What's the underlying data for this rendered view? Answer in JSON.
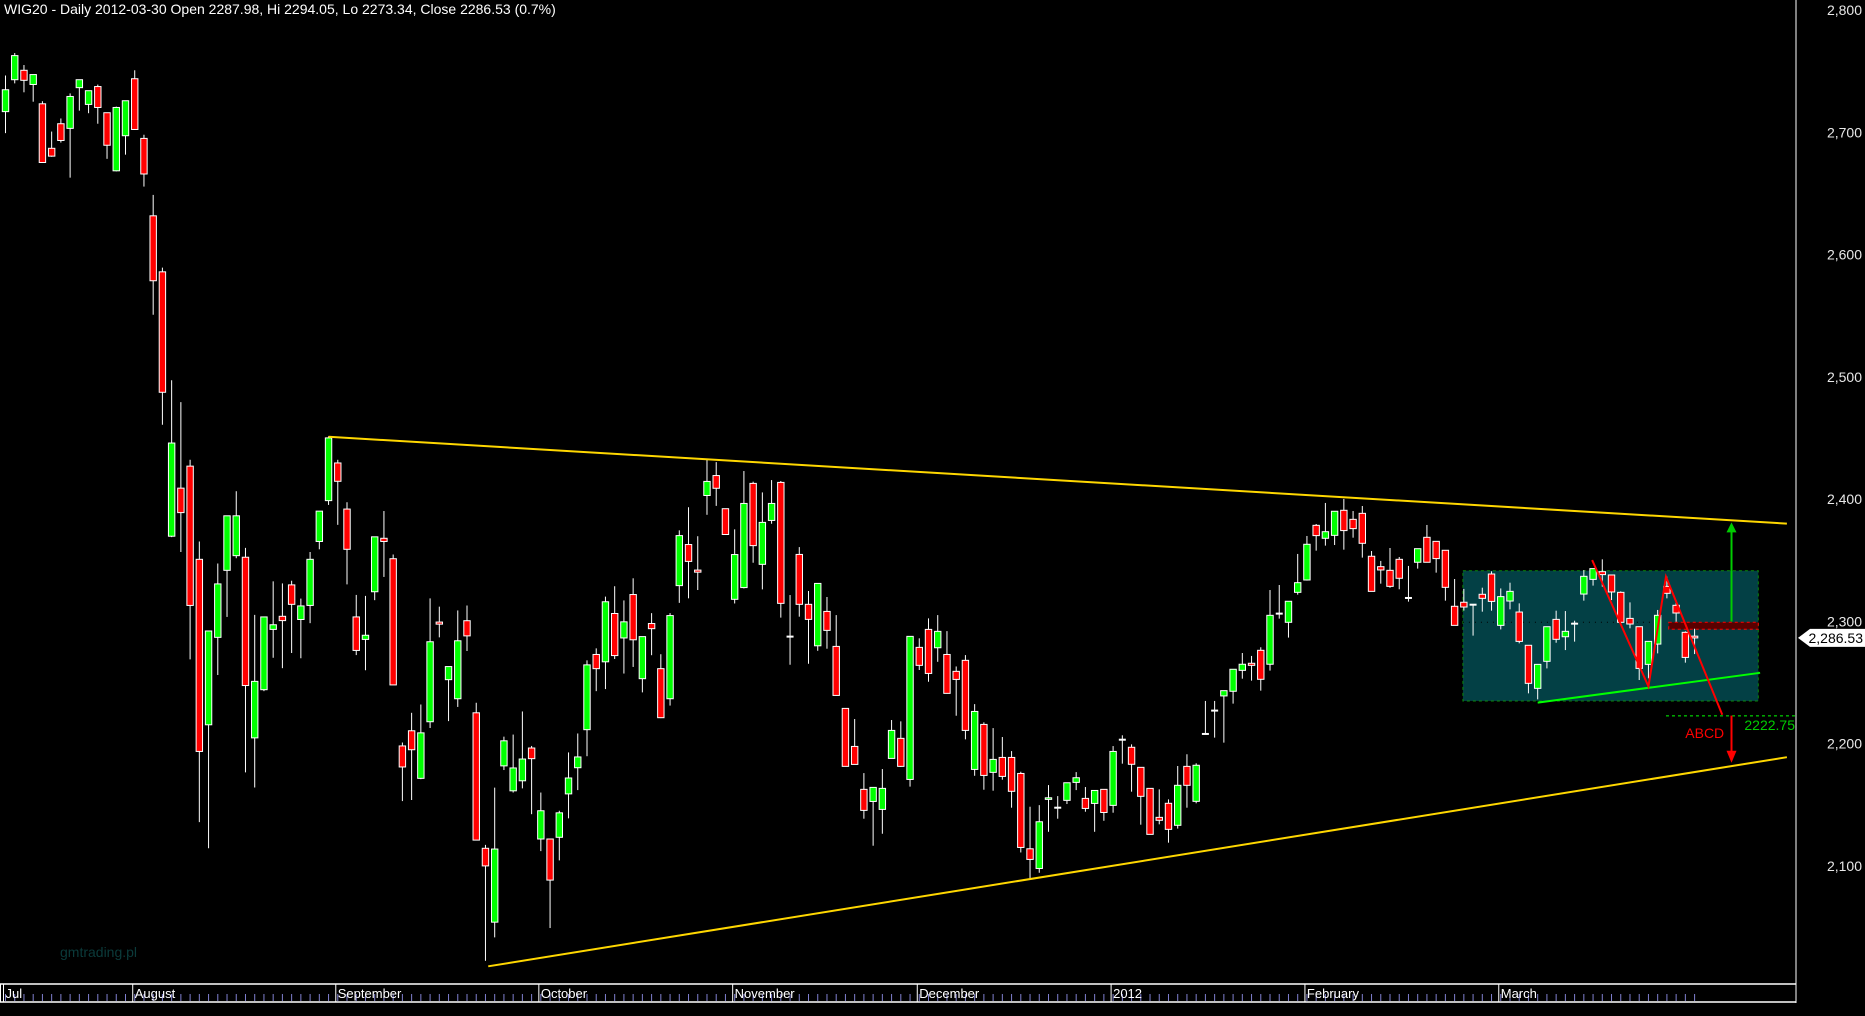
{
  "header": {
    "title": "WIG20 - Daily 2012-03-30 Open 2287.98, Hi 2294.05, Lo 2273.34, Close 2286.53 (0.7%)"
  },
  "watermark": "gmtrading.pl",
  "colors": {
    "background": "#000000",
    "up": "#00ff00",
    "down": "#ff0000",
    "trendline": "#ffd700",
    "box_fill": "#034045",
    "box_border": "#0a8a0a",
    "support": "#00ff00",
    "abcd": "#ff0000",
    "target_green": "#00cc00"
  },
  "chart_data": {
    "type": "candlestick",
    "symbol": "WIG20",
    "period": "Daily",
    "ylim": [
      2000,
      2800
    ],
    "y_ticks": [
      {
        "value": 2800,
        "label": "2,800"
      },
      {
        "value": 2700,
        "label": "2,700"
      },
      {
        "value": 2600,
        "label": "2,600"
      },
      {
        "value": 2500,
        "label": "2,500"
      },
      {
        "value": 2400,
        "label": "2,400"
      },
      {
        "value": 2300,
        "label": "2,300"
      },
      {
        "value": 2200,
        "label": "2,200"
      },
      {
        "value": 2100,
        "label": "2,100"
      }
    ],
    "x_months": [
      {
        "bar": 1,
        "label": "Jul"
      },
      {
        "bar": 15,
        "label": "August"
      },
      {
        "bar": 37,
        "label": "September"
      },
      {
        "bar": 59,
        "label": "October"
      },
      {
        "bar": 80,
        "label": "November"
      },
      {
        "bar": 100,
        "label": "December"
      },
      {
        "bar": 121,
        "label": "2012"
      },
      {
        "bar": 142,
        "label": "February"
      },
      {
        "bar": 163,
        "label": "March"
      }
    ],
    "last_price": {
      "value": 2286.53,
      "label": "2,286.53"
    },
    "ohlc_columns": [
      "open",
      "high",
      "low",
      "close"
    ],
    "candles": [
      [
        2716.9,
        2746.4,
        2699.3,
        2734.8
      ],
      [
        2743,
        2764.8,
        2740,
        2762.7
      ],
      [
        2750.7,
        2755,
        2732.7,
        2742.5
      ],
      [
        2739.1,
        2747.2,
        2725,
        2747.2
      ],
      [
        2723.3,
        2725.4,
        2675,
        2675.3
      ],
      [
        2686.9,
        2700.6,
        2680,
        2680.5
      ],
      [
        2707,
        2711.3,
        2691.6,
        2693.3
      ],
      [
        2703.2,
        2731.8,
        2662.9,
        2729.3
      ],
      [
        2736.5,
        2743,
        2717.7,
        2743
      ],
      [
        2722.8,
        2734,
        2715.6,
        2734
      ],
      [
        2737.4,
        2739,
        2707,
        2720.3
      ],
      [
        2716,
        2716,
        2678.3,
        2689.4
      ],
      [
        2668.5,
        2721,
        2668,
        2720.3
      ],
      [
        2697.2,
        2726,
        2681.7,
        2725.8
      ],
      [
        2743.8,
        2750.7,
        2702,
        2702.3
      ],
      [
        2695,
        2698,
        2655.6,
        2665.9
      ],
      [
        2631.7,
        2648.8,
        2550.8,
        2578.6
      ],
      [
        2585.9,
        2589.3,
        2460.8,
        2487.4
      ],
      [
        2369.7,
        2497.2,
        2369,
        2445.9
      ],
      [
        2409,
        2479.3,
        2356.8,
        2389
      ],
      [
        2427,
        2432.2,
        2269,
        2313.1
      ],
      [
        2350.8,
        2365.4,
        2135.9,
        2193.7
      ],
      [
        2215.5,
        2292.2,
        2114.5,
        2292.2
      ],
      [
        2287,
        2347.4,
        2256.2,
        2330.7
      ],
      [
        2341.8,
        2386.4,
        2303.7,
        2386.4
      ],
      [
        2353.8,
        2406.5,
        2351.7,
        2386.4
      ],
      [
        2352.5,
        2360.2,
        2176.6,
        2247.6
      ],
      [
        2204.8,
        2305.4,
        2164.2,
        2251
      ],
      [
        2244.2,
        2304,
        2243,
        2303.7
      ],
      [
        2293.5,
        2332.8,
        2270.3,
        2297.3
      ],
      [
        2304.2,
        2331.1,
        2261.8,
        2300.7
      ],
      [
        2329.9,
        2333.3,
        2274.2,
        2314
      ],
      [
        2301.6,
        2318.7,
        2269.9,
        2312.7
      ],
      [
        2313.1,
        2356.8,
        2298.6,
        2350.8
      ],
      [
        2365.4,
        2390.2,
        2359,
        2390.2
      ],
      [
        2398.8,
        2451.4,
        2395.3,
        2450.1
      ],
      [
        2429.6,
        2432.2,
        2379,
        2414.6
      ],
      [
        2391.9,
        2397.5,
        2330.3,
        2359
      ],
      [
        2303.7,
        2321.7,
        2272.5,
        2276.3
      ],
      [
        2285.3,
        2320.9,
        2260.1,
        2288.7
      ],
      [
        2324.3,
        2369.2,
        2317.4,
        2369.2
      ],
      [
        2368,
        2390.3,
        2336.4,
        2365.4
      ],
      [
        2351.3,
        2354.7,
        2248,
        2248.1
      ],
      [
        2198.2,
        2201,
        2153.1,
        2181
      ],
      [
        2210.6,
        2225.3,
        2154,
        2195.1
      ],
      [
        2171.7,
        2232.1,
        2171,
        2208.9
      ],
      [
        2218,
        2318.9,
        2212.9,
        2283.4
      ],
      [
        2299.5,
        2312.1,
        2287,
        2297.8
      ],
      [
        2252.4,
        2263.1,
        2218.5,
        2263.1
      ],
      [
        2236.8,
        2309,
        2230.1,
        2284.2
      ],
      [
        2300.6,
        2313,
        2275.8,
        2288.2
      ],
      [
        2225.3,
        2233.5,
        2121,
        2121.2
      ],
      [
        2114.5,
        2117.3,
        2022.5,
        2100.1
      ],
      [
        2054.1,
        2164.1,
        2041.7,
        2113.9
      ],
      [
        2181.9,
        2205.8,
        2178.5,
        2202.4
      ],
      [
        2161.5,
        2207.5,
        2160.1,
        2180.2
      ],
      [
        2169.7,
        2226.4,
        2163.5,
        2187.5
      ],
      [
        2196.5,
        2198.2,
        2142.4,
        2187.8
      ],
      [
        2122.1,
        2160.1,
        2112.2,
        2145.2
      ],
      [
        2122.1,
        2122.1,
        2049.3,
        2088.5
      ],
      [
        2123.5,
        2145.2,
        2104.6,
        2143.5
      ],
      [
        2159,
        2192.9,
        2139,
        2172
      ],
      [
        2180.4,
        2208.4,
        2162.1,
        2189.2
      ],
      [
        2211.5,
        2268.2,
        2189.8,
        2264.5
      ],
      [
        2273,
        2278,
        2243,
        2261.4
      ],
      [
        2267,
        2320.3,
        2244.7,
        2316.1
      ],
      [
        2306.5,
        2328.8,
        2269.3,
        2272.1
      ],
      [
        2286.5,
        2317.2,
        2257.4,
        2299.7
      ],
      [
        2322,
        2335.3,
        2262.8,
        2285
      ],
      [
        2253.2,
        2287.6,
        2242,
        2287.6
      ],
      [
        2298.3,
        2306.8,
        2272.4,
        2294.1
      ],
      [
        2261.4,
        2273.2,
        2221,
        2221.3
      ],
      [
        2236.8,
        2306.8,
        2231.2,
        2304.8
      ],
      [
        2329.3,
        2374.5,
        2315.2,
        2370.2
      ],
      [
        2362.9,
        2393.4,
        2318.9,
        2349.1
      ],
      [
        2342,
        2369.7,
        2325.7,
        2340.3
      ],
      [
        2403,
        2432.3,
        2387.2,
        2414.5
      ],
      [
        2419.3,
        2430.3,
        2394.5,
        2408.9
      ],
      [
        2392.2,
        2392.2,
        2371,
        2371.1
      ],
      [
        2318.1,
        2375.3,
        2314.7,
        2354.7
      ],
      [
        2327.7,
        2423,
        2327,
        2396.5
      ],
      [
        2412.9,
        2414.3,
        2348,
        2362
      ],
      [
        2346.7,
        2405.5,
        2326.2,
        2381
      ],
      [
        2382.6,
        2415.6,
        2379.9,
        2396.5
      ],
      [
        2413.7,
        2414.8,
        2303.1,
        2314.8
      ],
      [
        2287.5,
        2321.6,
        2264.6,
        2287.6
      ],
      [
        2354.8,
        2360.8,
        2303.9,
        2314
      ],
      [
        2314,
        2324.9,
        2265.4,
        2301.7
      ],
      [
        2280.1,
        2331.1,
        2276,
        2331.1
      ],
      [
        2308.2,
        2320,
        2277.7,
        2292.7
      ],
      [
        2279.6,
        2305.2,
        2239.5,
        2239.5
      ],
      [
        2228.9,
        2229,
        2181.5,
        2181.5
      ],
      [
        2197.8,
        2220.2,
        2183,
        2183.1
      ],
      [
        2162.7,
        2176,
        2138.7,
        2145.5
      ],
      [
        2152.8,
        2164.3,
        2116.6,
        2164.3
      ],
      [
        2146.3,
        2179.3,
        2126.4,
        2163.5
      ],
      [
        2188,
        2219.4,
        2188,
        2210.9
      ],
      [
        2204.4,
        2218.3,
        2181,
        2181.5
      ],
      [
        2170.8,
        2288,
        2164.9,
        2287.8
      ],
      [
        2278.8,
        2286.2,
        2260.3,
        2264.1
      ],
      [
        2293.5,
        2302.5,
        2250.7,
        2257.5
      ],
      [
        2278.5,
        2305.2,
        2267,
        2291.9
      ],
      [
        2273,
        2292.1,
        2241,
        2241.2
      ],
      [
        2259.2,
        2263.2,
        2222.9,
        2252.6
      ],
      [
        2268.2,
        2272.5,
        2203.6,
        2210.9
      ],
      [
        2179,
        2232.4,
        2173.8,
        2226.4
      ],
      [
        2215.8,
        2217.5,
        2162.4,
        2174.1
      ],
      [
        2176.6,
        2212.8,
        2161.6,
        2187.2
      ],
      [
        2188.8,
        2205.5,
        2170.6,
        2173.3
      ],
      [
        2188.8,
        2194,
        2147.7,
        2161.1
      ],
      [
        2175.7,
        2177.1,
        2111.1,
        2115.2
      ],
      [
        2114.1,
        2148.5,
        2089.9,
        2105.4
      ],
      [
        2098,
        2149.8,
        2094.5,
        2136.2
      ],
      [
        2154.5,
        2166.2,
        2128,
        2155.8
      ],
      [
        2147.7,
        2157.2,
        2138.7,
        2147.7
      ],
      [
        2153.7,
        2168.1,
        2150.7,
        2168.1
      ],
      [
        2168.4,
        2176.8,
        2162.1,
        2172.2
      ],
      [
        2155.3,
        2164.6,
        2144.4,
        2147.1
      ],
      [
        2151.2,
        2161.8,
        2128,
        2161.8
      ],
      [
        2162.7,
        2162.7,
        2137,
        2143.8
      ],
      [
        2149.6,
        2198.1,
        2143.6,
        2193.7
      ],
      [
        2203.3,
        2206.9,
        2183.7,
        2203.3
      ],
      [
        2197.1,
        2199.5,
        2160.8,
        2183.2
      ],
      [
        2180.7,
        2180.7,
        2133.8,
        2157
      ],
      [
        2163.5,
        2163.5,
        2125.9,
        2125.9
      ],
      [
        2139.8,
        2162.7,
        2134.1,
        2137.4
      ],
      [
        2151.3,
        2154.5,
        2119.1,
        2130
      ],
      [
        2133.3,
        2181.8,
        2130.6,
        2166
      ],
      [
        2181.5,
        2191.4,
        2147.7,
        2166
      ],
      [
        2152.9,
        2184,
        2151.3,
        2182.4
      ],
      [
        2208,
        2235,
        2208,
        2208
      ],
      [
        2226,
        2235,
        2205,
        2227.1
      ],
      [
        2239.1,
        2243.4,
        2200.9,
        2243.4
      ],
      [
        2242.9,
        2261,
        2232.8,
        2260.9
      ],
      [
        2260,
        2274.2,
        2253.2,
        2265
      ],
      [
        2265.8,
        2271.8,
        2251.6,
        2264.1
      ],
      [
        2276.4,
        2278.9,
        2243.4,
        2252.7
      ],
      [
        2265,
        2325.7,
        2259.8,
        2305
      ],
      [
        2306.4,
        2329.8,
        2302.3,
        2306.4
      ],
      [
        2299.3,
        2316.5,
        2286.8,
        2316.5
      ],
      [
        2323.8,
        2355.2,
        2321.9,
        2331.7
      ],
      [
        2333.9,
        2369.9,
        2333.4,
        2363.1
      ],
      [
        2378.6,
        2379.7,
        2357.9,
        2370.2
      ],
      [
        2368,
        2396.9,
        2362,
        2373.4
      ],
      [
        2370.4,
        2390.1,
        2362.5,
        2390.1
      ],
      [
        2390.9,
        2400.2,
        2358.7,
        2374.3
      ],
      [
        2383.5,
        2390.3,
        2368.5,
        2375.9
      ],
      [
        2388.4,
        2394.4,
        2352.2,
        2363.9
      ],
      [
        2353.3,
        2357.6,
        2324.6,
        2324.6
      ],
      [
        2344.8,
        2349.5,
        2330.9,
        2342.1
      ],
      [
        2341.8,
        2360.1,
        2327.6,
        2328.7
      ],
      [
        2350.8,
        2352.7,
        2326.3,
        2335.3
      ],
      [
        2320.3,
        2345.4,
        2316.2,
        2319.2
      ],
      [
        2348.4,
        2359.5,
        2343.2,
        2359.5
      ],
      [
        2368.8,
        2378.9,
        2348.4,
        2348.4
      ],
      [
        2365.5,
        2365.5,
        2339.9,
        2351.4
      ],
      [
        2358.2,
        2358.2,
        2317,
        2327.9
      ],
      [
        2312.4,
        2334.7,
        2296.8,
        2296.8
      ],
      [
        2315.7,
        2326.6,
        2308.9,
        2311.8
      ],
      [
        2313.7,
        2313.7,
        2288.4,
        2313.7
      ],
      [
        2322.2,
        2327.6,
        2308,
        2318.9
      ],
      [
        2338.8,
        2341,
        2308.8,
        2316.4
      ],
      [
        2296.8,
        2327,
        2293.5,
        2320.3
      ],
      [
        2316.7,
        2331.7,
        2309.9,
        2324.6
      ],
      [
        2307.7,
        2314.8,
        2282.1,
        2283.7
      ],
      [
        2280.5,
        2280.5,
        2241.2,
        2249.4
      ],
      [
        2245.3,
        2265,
        2236.3,
        2264.9
      ],
      [
        2267.4,
        2295.7,
        2261.6,
        2295.7
      ],
      [
        2301.7,
        2308.8,
        2282.6,
        2285.4
      ],
      [
        2287.5,
        2308.5,
        2276.6,
        2291.9
      ],
      [
        2298.2,
        2300.6,
        2283.5,
        2298.2
      ],
      [
        2322.4,
        2342,
        2317,
        2336.9
      ],
      [
        2334.4,
        2343.2,
        2329.3,
        2343.2
      ],
      [
        2340.7,
        2350.8,
        2328.4,
        2338.3
      ],
      [
        2338,
        2338,
        2317.5,
        2324.1
      ],
      [
        2323.8,
        2324.6,
        2298.5,
        2299.3
      ],
      [
        2302.5,
        2315.6,
        2294.4,
        2297.9
      ],
      [
        2295.7,
        2295.7,
        2252.1,
        2261.6
      ],
      [
        2264.9,
        2283.7,
        2253.5,
        2283.7
      ],
      [
        2281.5,
        2309.4,
        2273.9,
        2305
      ],
      [
        2328.7,
        2336.6,
        2318.9,
        2323
      ],
      [
        2313.2,
        2317,
        2299.8,
        2306.9
      ],
      [
        2291.1,
        2291.9,
        2266.3,
        2270.6
      ],
      [
        2287.98,
        2294.05,
        2273.34,
        2286.53
      ]
    ],
    "trendlines": [
      {
        "name": "upper-resistance",
        "from": {
          "bar": 36,
          "price": 2451
        },
        "to": {
          "bar": 194,
          "price": 2380
        }
      },
      {
        "name": "lower-support",
        "from": {
          "bar": 53.3,
          "price": 2018
        },
        "to": {
          "bar": 194,
          "price": 2189
        }
      },
      {
        "name": "range-support",
        "from": {
          "bar": 167,
          "price": 2233.6
        },
        "to": {
          "bar": 191.1,
          "price": 2258
        }
      }
    ],
    "range_box": {
      "from_bar": 158.9,
      "to_bar": 190.9,
      "top": 2341.5,
      "bottom": 2235
    },
    "dotted_level": {
      "from_bar": 158.9,
      "to_bar": 180,
      "price": 2299.3
    },
    "breakout_zone": {
      "from_bar": 181.2,
      "to_bar": 190.9,
      "top": 2299.3,
      "bottom": 2293.6
    },
    "abcd_pattern": {
      "label": "ABCD",
      "points": [
        {
          "bar": 172.9,
          "price": 2350.2
        },
        {
          "bar": 179,
          "price": 2246.9
        },
        {
          "bar": 180.9,
          "price": 2336.6
        },
        {
          "bar": 187,
          "price": 2223.7
        }
      ]
    },
    "target_level": {
      "price": 2222.75,
      "label": "2222.75",
      "from_bar": 180.9
    },
    "arrow_up": {
      "bar": 188,
      "from": 2300,
      "to": 2381
    },
    "arrow_down": {
      "bar": 188,
      "from": 2223,
      "to": 2184.5
    }
  }
}
